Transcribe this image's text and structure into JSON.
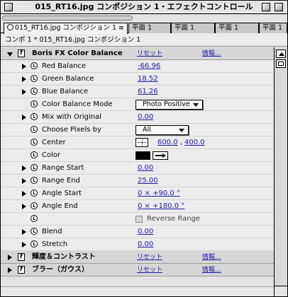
{
  "window": {
    "title": "015_RT16.jpg コンポジション 1・エフェクトコントロール"
  },
  "tabs": [
    {
      "label": "015_RT16.jpg コンポジション 1 ≡"
    },
    {
      "label": "平面 1"
    },
    {
      "label": "平面 1"
    },
    {
      "label": "平面 1"
    },
    {
      "label": "平面 1"
    }
  ],
  "breadcrumb": "コンポ 1 * 015_RT16.jpg コンポジション 1",
  "effect": {
    "name": "Boris FX Color Balance",
    "reset": "リセット",
    "about": "情報..."
  },
  "params": [
    {
      "label": "Red Balance",
      "value": "-66.96"
    },
    {
      "label": "Green Balance",
      "value": "18.52"
    },
    {
      "label": "Blue Balance",
      "value": "61.26"
    },
    {
      "label": "Color Balance Mode",
      "value": "Photo Positive"
    },
    {
      "label": "Mix with Original",
      "value": "0.00"
    },
    {
      "label": "Choose Pixels by",
      "value": "All"
    },
    {
      "label": "Center",
      "x": "600.0",
      "sep": ",",
      "y": "400.0"
    },
    {
      "label": "Color"
    },
    {
      "label": "Range Start",
      "value": "0.00"
    },
    {
      "label": "Range End",
      "value": "25.00"
    },
    {
      "label": "Angle Start",
      "value": "0 × +90.0 °"
    },
    {
      "label": "Angle End",
      "value": "0 × +180.0 °"
    },
    {
      "label": "Reverse Range"
    },
    {
      "label": "Blend",
      "value": "0.00"
    },
    {
      "label": "Stretch",
      "value": "0.00"
    }
  ],
  "effects_collapsed": [
    {
      "name": "輝度＆コントラスト",
      "reset": "リセット",
      "about": "情報..."
    },
    {
      "name": "ブラー（ガウス）",
      "reset": "リセット",
      "about": "情報..."
    }
  ]
}
